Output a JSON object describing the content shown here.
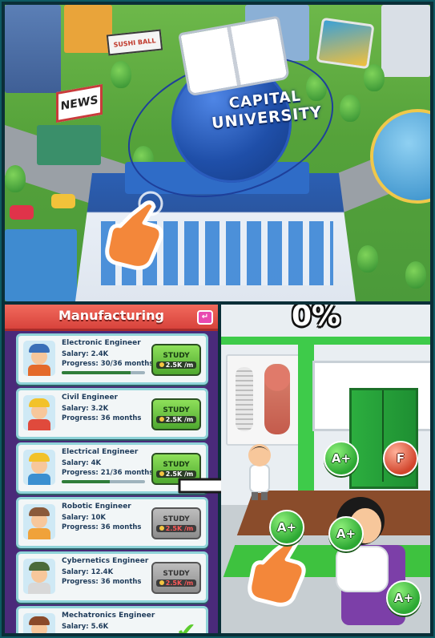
{
  "scene": {
    "sign_text": "CAPITAL UNIVERSITY",
    "sign_line1": "CAPITAL",
    "sign_line2": "UNIVERSITY",
    "news_text": "NEWS",
    "shop_text": "SUSHI BALL"
  },
  "panel": {
    "title": "Manufacturing",
    "back_icon": "back-arrow-icon",
    "jobs": [
      {
        "title": "Electronic Engineer",
        "salary": "Salary: 2.4K",
        "progress": "Progress: 30/36 months",
        "progress_value": 0.83,
        "button": "STUDY",
        "cost": "2.5K /m",
        "button_state": "enabled",
        "avatar_hat": "#3a6fb8",
        "avatar_body": "#e46a2a"
      },
      {
        "title": "Civil Engineer",
        "salary": "Salary: 3.2K",
        "progress": "Progress: 36 months",
        "progress_value": null,
        "button": "STUDY",
        "cost": "2.5K /m",
        "button_state": "enabled",
        "avatar_hat": "#f2c22a",
        "avatar_body": "#e04a3c"
      },
      {
        "title": "Electrical Engineer",
        "salary": "Salary: 4K",
        "progress": "Progress: 21/36 months",
        "progress_value": 0.58,
        "button": "STUDY",
        "cost": "2.5K /m",
        "button_state": "enabled",
        "avatar_hat": "#f2c22a",
        "avatar_body": "#3a8fd0"
      },
      {
        "title": "Robotic Engineer",
        "salary": "Salary: 10K",
        "progress": "Progress: 36 months",
        "progress_value": null,
        "button": "STUDY",
        "cost": "2.5K /m",
        "button_state": "disabled",
        "avatar_hat": "#8a5a3a",
        "avatar_body": "#f0a23a"
      },
      {
        "title": "Cybernetics Engineer",
        "salary": "Salary: 12.4K",
        "progress": "Progress: 36 months",
        "progress_value": null,
        "button": "STUDY",
        "cost": "2.5K /m",
        "button_state": "disabled",
        "avatar_hat": "#4a6a3a",
        "avatar_body": "#d8d8d8"
      },
      {
        "title": "Mechatronics Engineer",
        "salary": "Salary: 5.6K",
        "progress": "",
        "progress_value": null,
        "button": "",
        "cost": "",
        "button_state": "completed",
        "avatar_hat": "#8a4a2a",
        "avatar_body": "#3a8fd0"
      }
    ]
  },
  "classroom": {
    "percent": "0%",
    "grades": [
      {
        "label": "A+",
        "color": "green"
      },
      {
        "label": "F",
        "color": "red"
      },
      {
        "label": "A+",
        "color": "green"
      },
      {
        "label": "A+",
        "color": "green"
      },
      {
        "label": "A+",
        "color": "green"
      }
    ]
  },
  "colors": {
    "header_red": "#e4534a",
    "study_green": "#5fc23a",
    "card_border": "#8fd3d8",
    "panel_bg": "#4a2a7a"
  }
}
